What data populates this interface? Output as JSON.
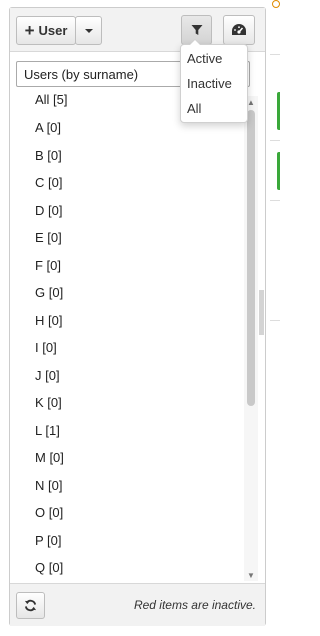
{
  "toolbar": {
    "add_user_label": "User",
    "add_user_icon": "plus-icon",
    "caret_icon": "chevron-down-icon",
    "filter_icon": "filter-icon",
    "dashboard_icon": "gauge-icon"
  },
  "filter_menu": {
    "items": [
      "Active",
      "Inactive",
      "All"
    ]
  },
  "users_select": {
    "value": "Users (by surname)"
  },
  "user_groups": [
    "All [5]",
    "A [0]",
    "B [0]",
    "C [0]",
    "D [0]",
    "E [0]",
    "F [0]",
    "G [0]",
    "H [0]",
    "I [0]",
    "J [0]",
    "K [0]",
    "L [1]",
    "M [0]",
    "N [0]",
    "O [0]",
    "P [0]",
    "Q [0]"
  ],
  "footer": {
    "refresh_icon": "refresh-icon",
    "note": "Red items are inactive."
  },
  "colors": {
    "accent_green": "#3aa83a",
    "border": "#cccccc",
    "toolbar_bg": "#f2f2f2"
  }
}
